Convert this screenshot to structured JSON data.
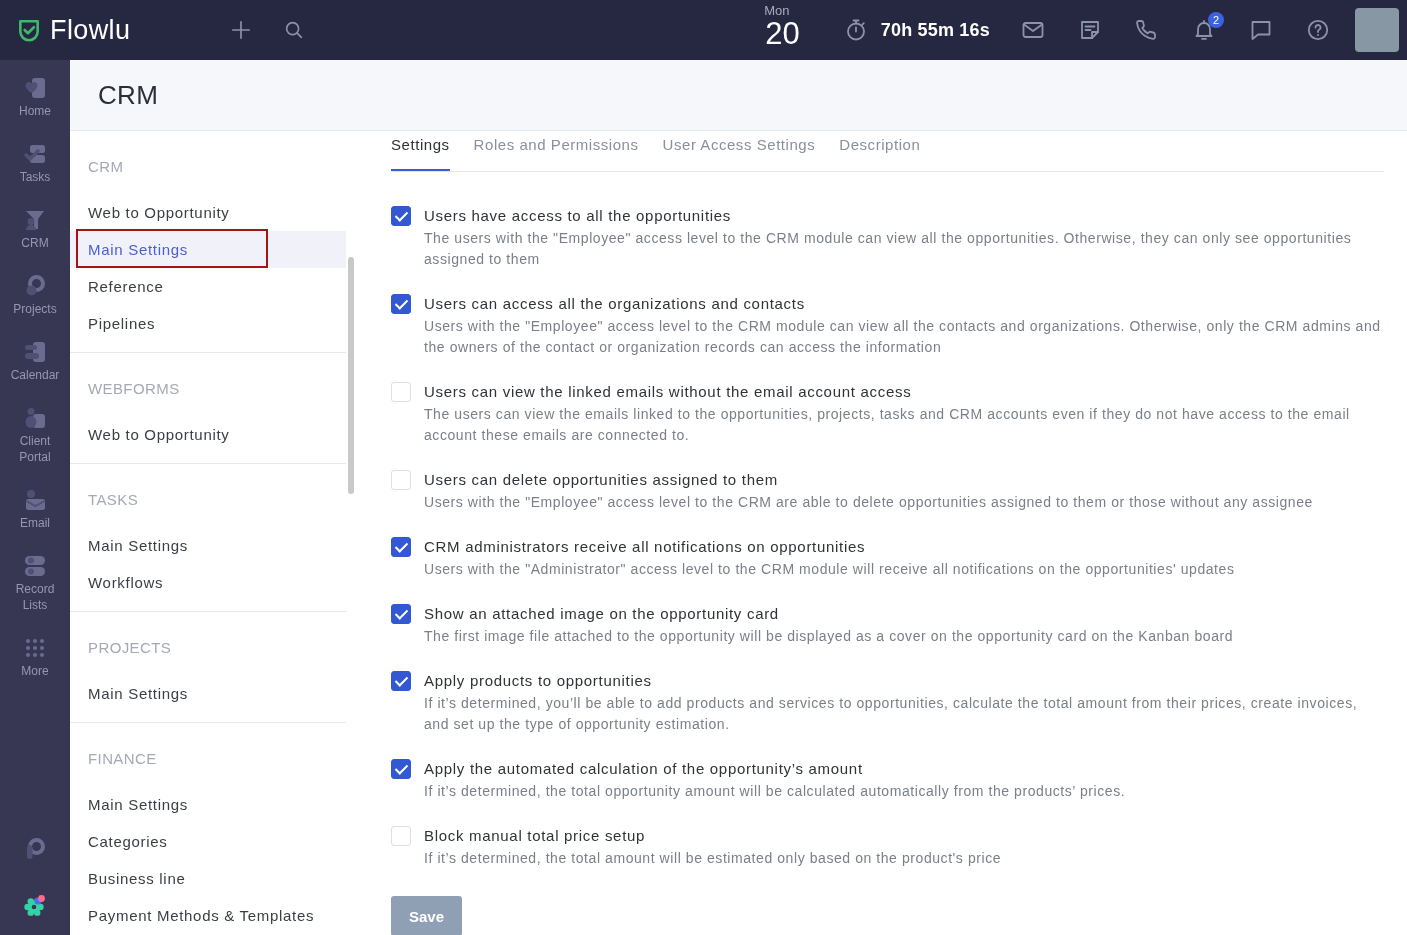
{
  "top_bar": {
    "logo_text": "Flowlu",
    "date": {
      "weekday": "Mon",
      "day": "20"
    },
    "timer": "70h 55m 16s",
    "notification_count": "2"
  },
  "nav": {
    "items": [
      {
        "label": "Home"
      },
      {
        "label": "Tasks"
      },
      {
        "label": "CRM"
      },
      {
        "label": "Projects"
      },
      {
        "label": "Calendar"
      },
      {
        "label": "Client Portal"
      },
      {
        "label": "Email"
      },
      {
        "label": "Record Lists"
      },
      {
        "label": "More"
      }
    ]
  },
  "page_header": {
    "title": "CRM"
  },
  "settings_nav": {
    "sections": [
      {
        "title": "CRM",
        "items": [
          {
            "label": "Web to Opportunity",
            "selected": false,
            "outlined": false
          },
          {
            "label": "Main Settings",
            "selected": true,
            "outlined": true
          },
          {
            "label": "Reference",
            "selected": false,
            "outlined": false
          },
          {
            "label": "Pipelines",
            "selected": false,
            "outlined": false
          }
        ]
      },
      {
        "title": "WEBFORMS",
        "items": [
          {
            "label": "Web to Opportunity",
            "selected": false,
            "outlined": false
          }
        ]
      },
      {
        "title": "TASKS",
        "items": [
          {
            "label": "Main Settings",
            "selected": false,
            "outlined": false
          },
          {
            "label": "Workflows",
            "selected": false,
            "outlined": false
          }
        ]
      },
      {
        "title": "PROJECTS",
        "items": [
          {
            "label": "Main Settings",
            "selected": false,
            "outlined": false
          }
        ]
      },
      {
        "title": "FINANCE",
        "items": [
          {
            "label": "Main Settings",
            "selected": false,
            "outlined": false
          },
          {
            "label": "Categories",
            "selected": false,
            "outlined": false
          },
          {
            "label": "Business line",
            "selected": false,
            "outlined": false
          },
          {
            "label": "Payment Methods & Templates",
            "selected": false,
            "outlined": false
          }
        ]
      }
    ]
  },
  "tabs": [
    {
      "label": "Settings",
      "selected": true
    },
    {
      "label": "Roles and Permissions",
      "selected": false
    },
    {
      "label": "User Access Settings",
      "selected": false
    },
    {
      "label": "Description",
      "selected": false
    }
  ],
  "options": [
    {
      "title": "Users have access to all the opportunities",
      "description": "The users with the \"Employee\" access level to the CRM module can view all the opportunities. Otherwise, they can only see opportunities assigned to them",
      "checked": true
    },
    {
      "title": "Users can access all the organizations and contacts",
      "description": "Users with the \"Employee\" access level to the CRM module can view all the contacts and organizations. Otherwise, only the CRM admins and the owners of the contact or organization records can access the information",
      "checked": true
    },
    {
      "title": "Users can view the linked emails without the email account access",
      "description": "The users can view the emails linked to the opportunities, projects, tasks and CRM accounts even if they do not have access to the email account these emails are connected to.",
      "checked": false
    },
    {
      "title": "Users can delete opportunities assigned to them",
      "description": "Users with the \"Employee\" access level to the CRM are able to delete opportunities assigned to them or those without any assignee",
      "checked": false
    },
    {
      "title": "CRM administrators receive all notifications on opportunities",
      "description": "Users with the \"Administrator\" access level to the CRM module will receive all notifications on the opportunities' updates",
      "checked": true
    },
    {
      "title": "Show an attached image on the opportunity card",
      "description": "The first image file attached to the opportunity will be displayed as a cover on the opportunity card on the Kanban board",
      "checked": true
    },
    {
      "title": "Apply products to opportunities",
      "description": "If it’s determined, you’ll be able to add products and services to opportunities, calculate the total amount from their prices, create invoices, and set up the type of opportunity estimation.",
      "checked": true
    },
    {
      "title": "Apply the automated calculation of the opportunity’s amount",
      "description": "If it’s determined, the total opportunity amount will be calculated automatically from the products’ prices.",
      "checked": true
    },
    {
      "title": "Block manual total price setup",
      "description": "If it’s determined, the total amount will be estimated only based on the product's price",
      "checked": false
    }
  ],
  "save_button": {
    "label": "Save",
    "disabled": true
  }
}
